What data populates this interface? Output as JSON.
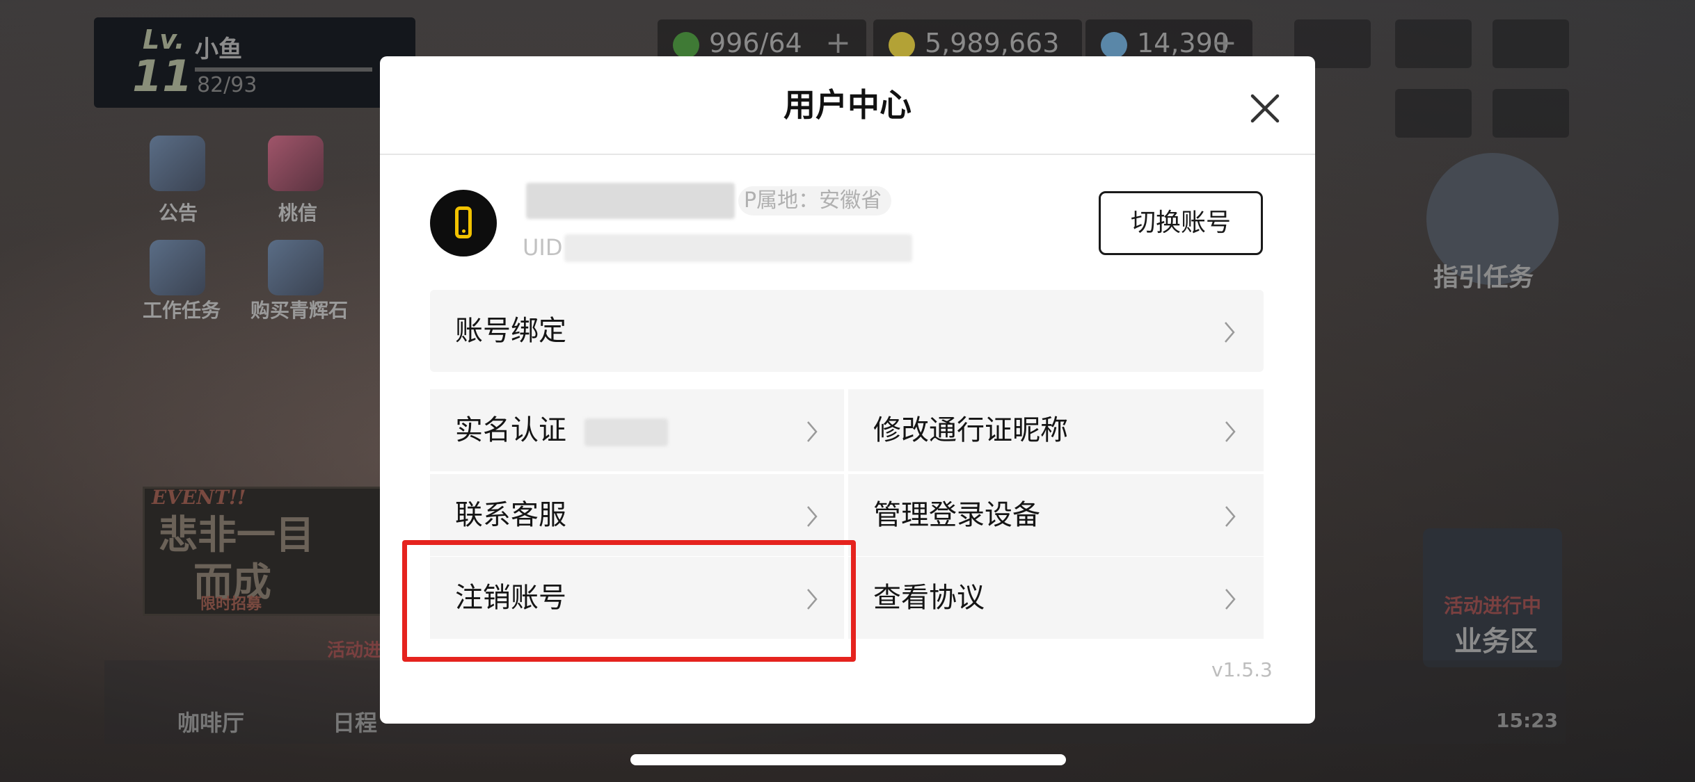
{
  "game": {
    "level_tag": "Lv.",
    "level": "11",
    "player_name": "小鱼",
    "exp": "82/93",
    "resources": [
      {
        "value": "996/64",
        "plus": "+",
        "color": "#3f7a35"
      },
      {
        "value": "5,989,663",
        "plus": "",
        "color": "#b3a236"
      },
      {
        "value": "14,390",
        "plus": "+",
        "color": "#5a87a8"
      }
    ],
    "side_items": [
      "公告",
      "桃信",
      "工作任务",
      "购买青辉石"
    ],
    "guide_task": "指引任务",
    "event": {
      "tag": "EVENT!!",
      "line1": "悲非一目",
      "line2": "而成",
      "sub": "限时招募"
    },
    "activity_badge_left": "活动进",
    "activity_badge_right": "活动进行中",
    "business_area": "业务区",
    "bottom_tabs": [
      "咖啡厅",
      "日程"
    ],
    "time": "15:23"
  },
  "modal": {
    "title": "用户中心",
    "account": {
      "ip_location": "P属地：安徽省",
      "uid_prefix": "UID"
    },
    "switch_account": "切换账号",
    "menu": {
      "bind_account": "账号绑定",
      "real_name": "实名认证",
      "edit_nickname": "修改通行证昵称",
      "contact_service": "联系客服",
      "manage_devices": "管理登录设备",
      "cancel_account": "注销账号",
      "view_agreement": "查看协议"
    },
    "version": "v1.5.3"
  },
  "colors": {
    "highlight": "#e5231e",
    "phone_icon": "#f2c200",
    "row_bg": "#f5f5f5"
  },
  "icons": [
    "close-icon",
    "phone-icon",
    "chevron-right-icon"
  ]
}
